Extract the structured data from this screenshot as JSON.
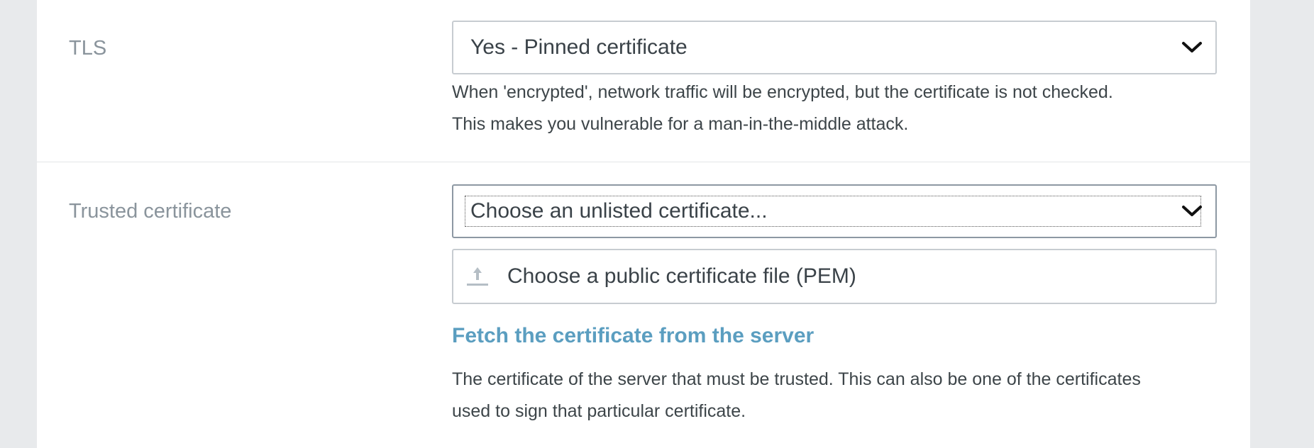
{
  "tls": {
    "label": "TLS",
    "selected": "Yes - Pinned certificate",
    "help_line1": "When 'encrypted', network traffic will be encrypted, but the certificate is not checked.",
    "help_line2": "This makes you vulnerable for a man-in-the-middle attack."
  },
  "trusted_certificate": {
    "label": "Trusted certificate",
    "selected": "Choose an unlisted certificate...",
    "file_input_label": "Choose a public certificate file (PEM)",
    "fetch_link": "Fetch the certificate from the server",
    "help_line1": "The certificate of the server that must be trusted. This can also be one of the certificates",
    "help_line2": "used to sign that particular certificate."
  },
  "icons": {
    "dropdown": "chevron-down-icon",
    "upload": "upload-icon"
  },
  "colors": {
    "link": "#5b9ec0",
    "label": "#8a949c",
    "text": "#3a4248",
    "border": "#c7ccd1"
  }
}
